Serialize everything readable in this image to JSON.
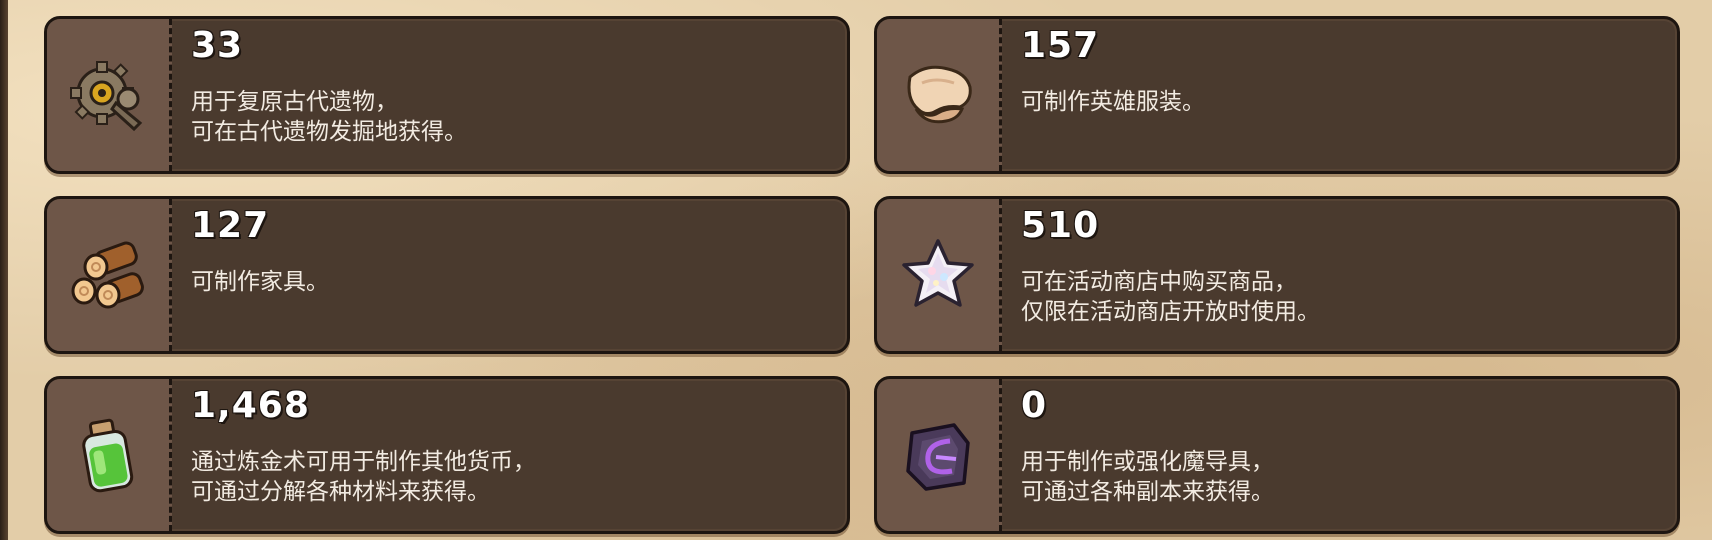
{
  "items": [
    {
      "icon": "gear-relic-icon",
      "count": "33",
      "lines": [
        "用于复原古代遗物，",
        "可在古代遗物发掘地获得。"
      ]
    },
    {
      "icon": "cloth-icon",
      "count": "157",
      "lines": [
        "可制作英雄服装。"
      ]
    },
    {
      "icon": "wood-logs-icon",
      "count": "127",
      "lines": [
        "可制作家具。"
      ]
    },
    {
      "icon": "star-icon",
      "count": "510",
      "lines": [
        "可在活动商店中购买商品，",
        "仅限在活动商店开放时使用。"
      ]
    },
    {
      "icon": "potion-bottle-icon",
      "count": "1,468",
      "lines": [
        "通过炼金术可用于制作其他货币，",
        "可通过分解各种材料来获得。"
      ]
    },
    {
      "icon": "dark-crystal-icon",
      "count": "0",
      "lines": [
        "用于制作或强化魔导具，",
        "可通过各种副本来获得。"
      ]
    }
  ]
}
